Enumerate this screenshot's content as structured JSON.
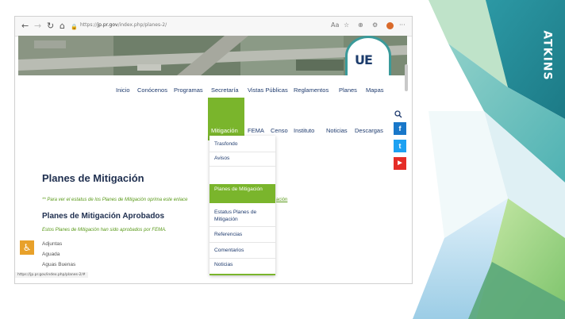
{
  "brand": {
    "logo_text": "ATKINS"
  },
  "browser": {
    "buttons": {
      "back": "←",
      "forward": "→",
      "reload": "↻",
      "home": "⌂",
      "lock": "🔒"
    },
    "url_prefix": "https://",
    "url_domain": "jp.pr.gov",
    "url_path": "/index.php/planes-2/",
    "right_icons": [
      "☆",
      "⊕",
      "⚙"
    ],
    "menu": "···",
    "status_url": "https://jp.pr.gov/index.php/planes-2/#"
  },
  "site": {
    "logo": "UE",
    "nav_primary": [
      "Inicio",
      "Conócenos",
      "Programas",
      "Secretaría",
      "Vistas Públicas",
      "Reglamentos",
      "Planes",
      "Mapas"
    ],
    "nav_secondary": [
      "Mitigación",
      "FEMA",
      "Censo",
      "Instituto",
      "Noticias",
      "Descargas"
    ],
    "social": {
      "facebook": "f",
      "twitter": "t",
      "youtube": "▶"
    },
    "dropdown": [
      "Trasfondo",
      "Avisos",
      "Planes de Mitigación",
      "Estatus Planes de Mitigación",
      "Referencias",
      "Comentarios",
      "Noticias"
    ],
    "dropdown_selected": "Planes de Mitigación"
  },
  "content": {
    "title": "Planes de Mitigación",
    "note": "** Para ver el estatus de los Planes de Mitigación oprima este enlace",
    "note_link": "ación",
    "subtitle": "Planes de Mitigación Aprobados",
    "approved_note": "Estos Planes de Mitigación han sido aprobados por FEMA.",
    "towns": [
      "Adjuntas",
      "Aguada",
      "Aguas Buenas"
    ],
    "accessibility": "♿"
  },
  "colors": {
    "accent_green": "#7ab52c",
    "navy": "#1f3b6e",
    "teal": "#3aa3a6",
    "facebook": "#1877c9",
    "twitter": "#1da1f2",
    "youtube": "#e52d27"
  }
}
